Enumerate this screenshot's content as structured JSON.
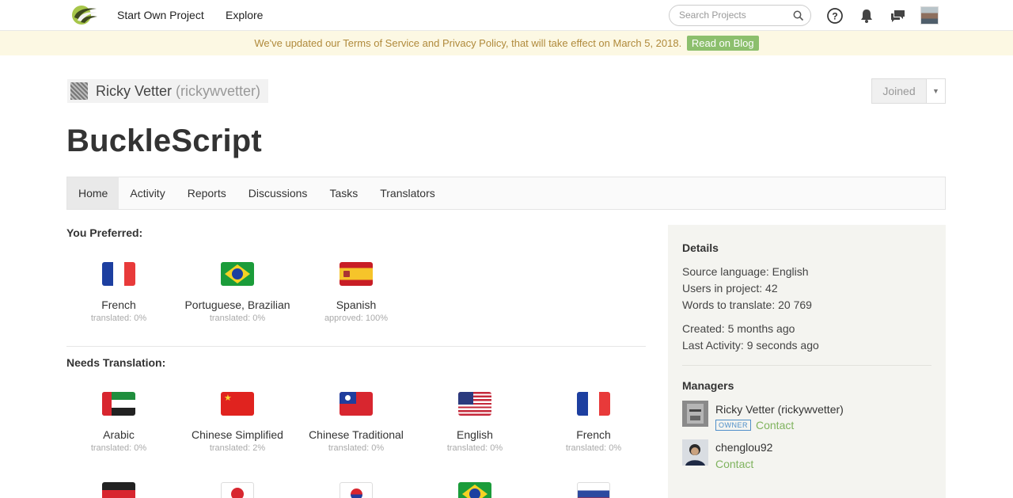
{
  "nav": {
    "start_project": "Start Own Project",
    "explore": "Explore",
    "search_placeholder": "Search Projects"
  },
  "banner": {
    "text": "We've updated our Terms of Service and Privacy Policy, that will take effect on March 5, 2018.",
    "button": "Read on Blog"
  },
  "owner": {
    "name": "Ricky Vetter",
    "handle": "(rickywvetter)"
  },
  "join_button": "Joined",
  "project_title": "BuckleScript",
  "tabs": [
    "Home",
    "Activity",
    "Reports",
    "Discussions",
    "Tasks",
    "Translators"
  ],
  "preferred": {
    "heading": "You Preferred:",
    "languages": [
      {
        "name": "French",
        "status": "translated: 0%",
        "flag": "fr"
      },
      {
        "name": "Portuguese, Brazilian",
        "status": "translated: 0%",
        "flag": "br"
      },
      {
        "name": "Spanish",
        "status": "approved: 100%",
        "flag": "es"
      }
    ]
  },
  "needs": {
    "heading": "Needs Translation:",
    "languages": [
      {
        "name": "Arabic",
        "status": "translated: 0%",
        "flag": "ae"
      },
      {
        "name": "Chinese Simplified",
        "status": "translated: 2%",
        "flag": "cn"
      },
      {
        "name": "Chinese Traditional",
        "status": "translated: 0%",
        "flag": "tw"
      },
      {
        "name": "English",
        "status": "translated: 0%",
        "flag": "us"
      },
      {
        "name": "French",
        "status": "translated: 0%",
        "flag": "fr"
      }
    ],
    "partial_flags": [
      "de",
      "jp",
      "kr",
      "br",
      "ru"
    ]
  },
  "details": {
    "heading": "Details",
    "source_language": "Source language: English",
    "users": "Users in project: 42",
    "words": "Words to translate: 20 769",
    "created": "Created: 5 months ago",
    "last_activity": "Last Activity: 9 seconds ago"
  },
  "managers": {
    "heading": "Managers",
    "list": [
      {
        "name": "Ricky Vetter (rickywvetter)",
        "tag": "OWNER",
        "contact": "Contact"
      },
      {
        "name": "chenglou92",
        "contact": "Contact"
      }
    ]
  },
  "colors": {
    "accent_green": "#8cbf6d",
    "banner_bg": "#fcf8e3",
    "owner_tag_blue": "#4f8fc9"
  }
}
